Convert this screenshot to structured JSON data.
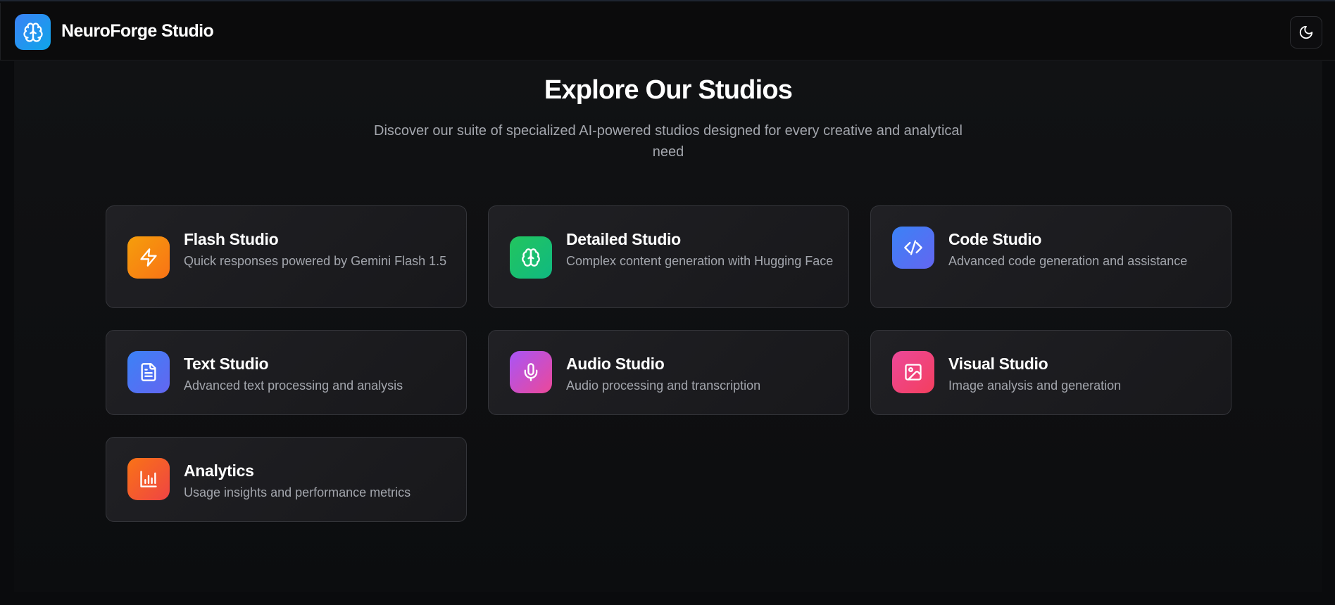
{
  "header": {
    "app_title": "NeuroForge Studio",
    "logo_icon": "brain-icon",
    "theme_toggle_icon": "moon-icon"
  },
  "main": {
    "title": "Explore Our Studios",
    "subtitle": "Discover our suite of specialized AI-powered studios designed for every creative and analytical need"
  },
  "studios": [
    {
      "title": "Flash Studio",
      "description": "Quick responses powered by Gemini Flash 1.5",
      "icon": "lightning-icon",
      "gradient": [
        "#f59e0b",
        "#f97316"
      ]
    },
    {
      "title": "Detailed Studio",
      "description": "Complex content generation with Hugging Face",
      "icon": "brain-icon",
      "gradient": [
        "#22c55e",
        "#10b981"
      ]
    },
    {
      "title": "Code Studio",
      "description": "Advanced code generation and assistance",
      "icon": "code-icon",
      "gradient": [
        "#3b82f6",
        "#6366f1"
      ]
    },
    {
      "title": "Text Studio",
      "description": "Advanced text processing and analysis",
      "icon": "document-icon",
      "gradient": [
        "#3b82f6",
        "#6366f1"
      ]
    },
    {
      "title": "Audio Studio",
      "description": "Audio processing and transcription",
      "icon": "microphone-icon",
      "gradient": [
        "#a855f7",
        "#ec4899"
      ]
    },
    {
      "title": "Visual Studio",
      "description": "Image analysis and generation",
      "icon": "image-icon",
      "gradient": [
        "#ec4899",
        "#f43f5e"
      ]
    },
    {
      "title": "Analytics",
      "description": "Usage insights and performance metrics",
      "icon": "bar-chart-icon",
      "gradient": [
        "#f97316",
        "#ef4444"
      ]
    }
  ]
}
